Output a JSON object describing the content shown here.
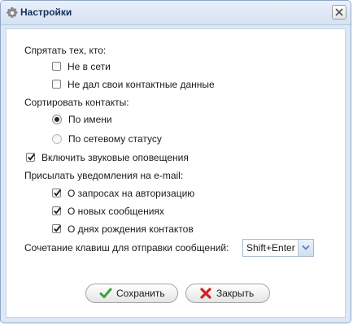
{
  "window": {
    "title": "Настройки",
    "icons": {
      "title": "gear-icon",
      "close": "close-icon"
    }
  },
  "hide": {
    "label": "Спрятать тех, кто:",
    "items": [
      {
        "label": "Не в сети",
        "checked": false
      },
      {
        "label": "Не дал свои контактные данные",
        "checked": false
      }
    ]
  },
  "sort": {
    "label": "Сортировать контакты:",
    "options": [
      {
        "label": "По имени",
        "selected": true
      },
      {
        "label": "По сетевому статусу",
        "selected": false
      }
    ]
  },
  "sound": {
    "label": "Включить звуковые оповещения",
    "checked": true
  },
  "email": {
    "label": "Присылать уведомления на e-mail:",
    "items": [
      {
        "label": "О запросах на авторизацию",
        "checked": true
      },
      {
        "label": "О новых сообщениях",
        "checked": true
      },
      {
        "label": "О днях рождения контактов",
        "checked": true
      }
    ]
  },
  "hotkey": {
    "label": "Сочетание клавиш для отправки сообщений:",
    "value": "Shift+Enter"
  },
  "buttons": {
    "save": {
      "label": "Сохранить",
      "icon": "checkmark-icon",
      "color": "#3aa23a"
    },
    "close": {
      "label": "Закрыть",
      "icon": "cross-icon",
      "color": "#d42020"
    }
  }
}
